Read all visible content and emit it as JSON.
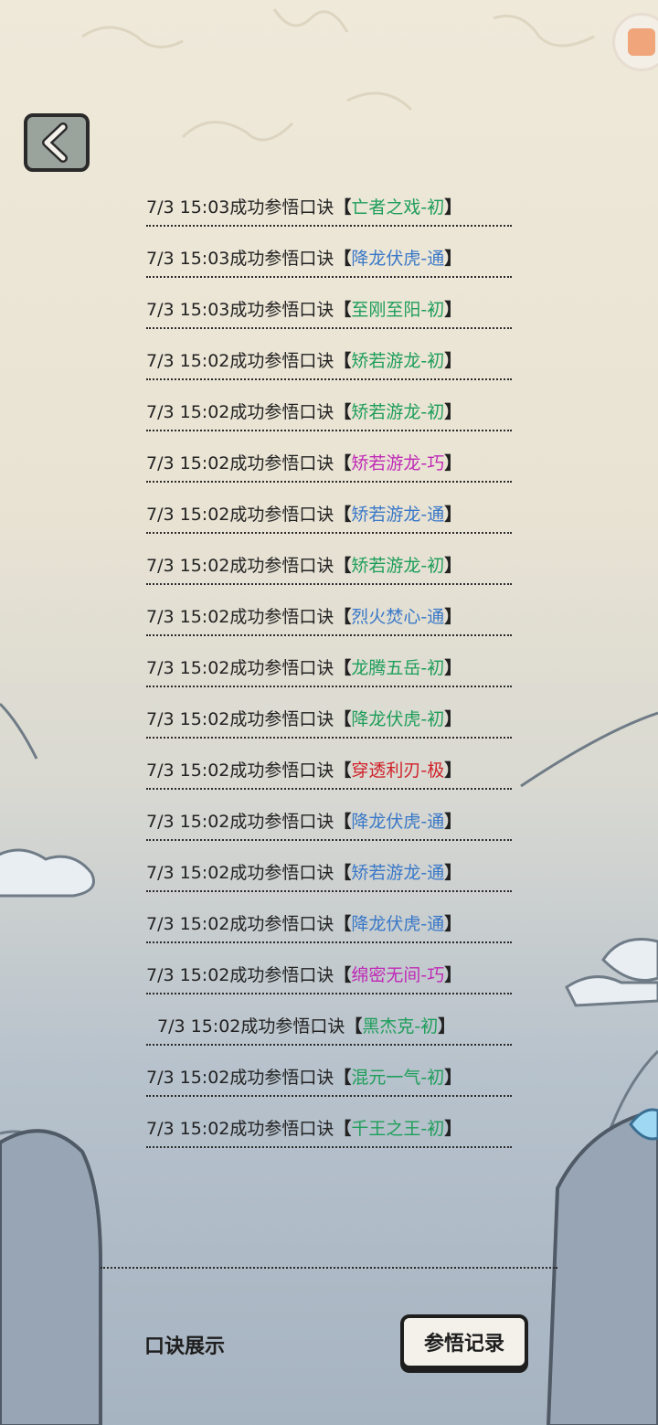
{
  "header": {
    "back_icon": "chevron-left-icon"
  },
  "records": [
    {
      "time": "7/3 15:03",
      "action": "成功参悟口诀",
      "skill": "亡者之戏-初",
      "tier_color": "#1e9e5a"
    },
    {
      "time": "7/3 15:03",
      "action": "成功参悟口诀",
      "skill": "降龙伏虎-通",
      "tier_color": "#3a78c8"
    },
    {
      "time": "7/3 15:03",
      "action": "成功参悟口诀",
      "skill": "至刚至阳-初",
      "tier_color": "#1e9e5a"
    },
    {
      "time": "7/3 15:02",
      "action": "成功参悟口诀",
      "skill": "矫若游龙-初",
      "tier_color": "#1e9e5a"
    },
    {
      "time": "7/3 15:02",
      "action": "成功参悟口诀",
      "skill": "矫若游龙-初",
      "tier_color": "#1e9e5a"
    },
    {
      "time": "7/3 15:02",
      "action": "成功参悟口诀",
      "skill": "矫若游龙-巧",
      "tier_color": "#c02ab6"
    },
    {
      "time": "7/3 15:02",
      "action": "成功参悟口诀",
      "skill": "矫若游龙-通",
      "tier_color": "#3a78c8"
    },
    {
      "time": "7/3 15:02",
      "action": "成功参悟口诀",
      "skill": "矫若游龙-初",
      "tier_color": "#1e9e5a"
    },
    {
      "time": "7/3 15:02",
      "action": "成功参悟口诀",
      "skill": "烈火焚心-通",
      "tier_color": "#3a78c8"
    },
    {
      "time": "7/3 15:02",
      "action": "成功参悟口诀",
      "skill": "龙腾五岳-初",
      "tier_color": "#1e9e5a"
    },
    {
      "time": "7/3 15:02",
      "action": "成功参悟口诀",
      "skill": "降龙伏虎-初",
      "tier_color": "#1e9e5a"
    },
    {
      "time": "7/3 15:02",
      "action": "成功参悟口诀",
      "skill": "穿透利刃-极",
      "tier_color": "#d0222a"
    },
    {
      "time": "7/3 15:02",
      "action": "成功参悟口诀",
      "skill": "降龙伏虎-通",
      "tier_color": "#3a78c8"
    },
    {
      "time": "7/3 15:02",
      "action": "成功参悟口诀",
      "skill": "矫若游龙-通",
      "tier_color": "#3a78c8"
    },
    {
      "time": "7/3 15:02",
      "action": "成功参悟口诀",
      "skill": "降龙伏虎-通",
      "tier_color": "#3a78c8"
    },
    {
      "time": "7/3 15:02",
      "action": "成功参悟口诀",
      "skill": "绵密无间-巧",
      "tier_color": "#c02ab6"
    },
    {
      "time": "7/3 15:02",
      "action": "成功参悟口诀",
      "skill": "黑杰克-初",
      "tier_color": "#1e9e5a"
    },
    {
      "time": "7/3 15:02",
      "action": "成功参悟口诀",
      "skill": "混元一气-初",
      "tier_color": "#1e9e5a"
    },
    {
      "time": "7/3 15:02",
      "action": "成功参悟口诀",
      "skill": "千王之王-初",
      "tier_color": "#1e9e5a"
    }
  ],
  "brackets": {
    "open": "【",
    "close": "】"
  },
  "footer": {
    "tab_display": "口诀展示",
    "tab_records": "参悟记录"
  }
}
